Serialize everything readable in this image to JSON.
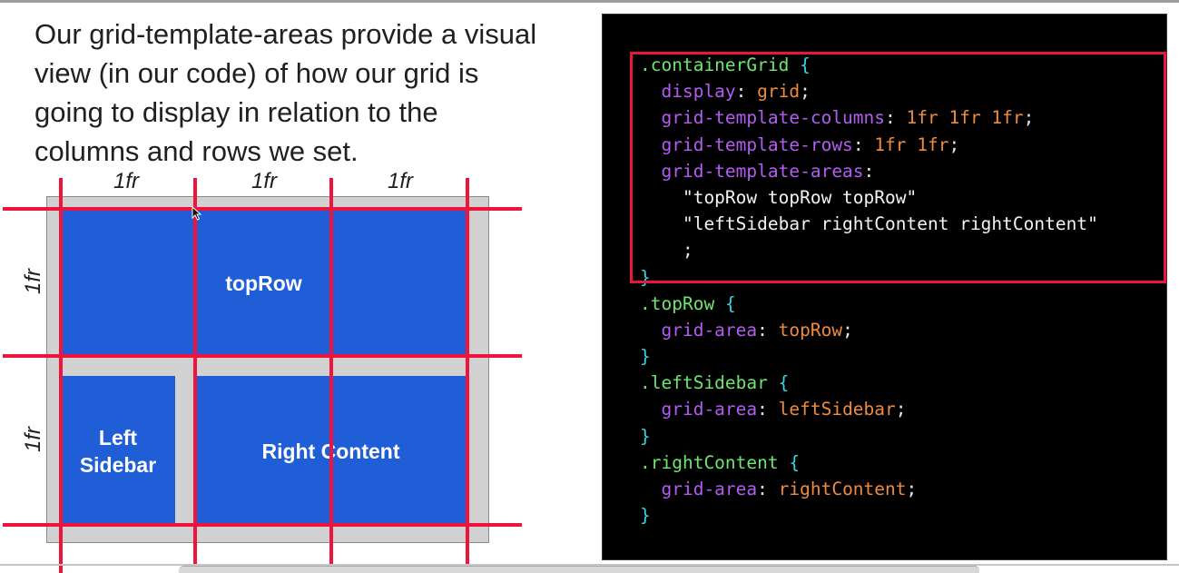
{
  "paragraph": {
    "lines": [
      "Our grid-template-areas provide a visual",
      "view (in our code) of how our grid is",
      "going to display in relation to the",
      "columns and rows we set."
    ]
  },
  "diagram": {
    "column_labels": [
      "1fr",
      "1fr",
      "1fr"
    ],
    "row_labels": [
      "1fr",
      "1fr"
    ],
    "areas": {
      "top": "topRow",
      "left": "Left\nSidebar",
      "right": "Right Content"
    },
    "colors": {
      "cell": "#1f5ed6",
      "gap": "#d1d1d1",
      "grid_line": "#f0143c"
    }
  },
  "code": {
    "lines": [
      [
        {
          "t": ".containerGrid",
          "c": "sel"
        },
        {
          "t": " ",
          "c": "punct"
        },
        {
          "t": "{",
          "c": "brace"
        }
      ],
      [
        {
          "t": "  display",
          "c": "prop"
        },
        {
          "t": ": ",
          "c": "punct"
        },
        {
          "t": "grid",
          "c": "val"
        },
        {
          "t": ";",
          "c": "punct"
        }
      ],
      [
        {
          "t": "  grid-template-columns",
          "c": "prop"
        },
        {
          "t": ": ",
          "c": "punct"
        },
        {
          "t": "1fr 1fr 1fr",
          "c": "val"
        },
        {
          "t": ";",
          "c": "punct"
        }
      ],
      [
        {
          "t": "  grid-template-rows",
          "c": "prop"
        },
        {
          "t": ": ",
          "c": "punct"
        },
        {
          "t": "1fr 1fr",
          "c": "val"
        },
        {
          "t": ";",
          "c": "punct"
        }
      ],
      [
        {
          "t": "  grid-template-areas",
          "c": "prop"
        },
        {
          "t": ":",
          "c": "punct"
        }
      ],
      [
        {
          "t": "    \"topRow topRow topRow\"",
          "c": "str"
        }
      ],
      [
        {
          "t": "    \"leftSidebar rightContent rightContent\"",
          "c": "str"
        }
      ],
      [
        {
          "t": "    ;",
          "c": "punct"
        }
      ],
      [
        {
          "t": "}",
          "c": "brace"
        }
      ],
      [
        {
          "t": ".topRow",
          "c": "sel"
        },
        {
          "t": " ",
          "c": "punct"
        },
        {
          "t": "{",
          "c": "brace"
        }
      ],
      [
        {
          "t": "  grid-area",
          "c": "prop"
        },
        {
          "t": ": ",
          "c": "punct"
        },
        {
          "t": "topRow",
          "c": "val"
        },
        {
          "t": ";",
          "c": "punct"
        }
      ],
      [
        {
          "t": "}",
          "c": "brace"
        }
      ],
      [
        {
          "t": ".leftSidebar",
          "c": "sel"
        },
        {
          "t": " ",
          "c": "punct"
        },
        {
          "t": "{",
          "c": "brace"
        }
      ],
      [
        {
          "t": "  grid-area",
          "c": "prop"
        },
        {
          "t": ": ",
          "c": "punct"
        },
        {
          "t": "leftSidebar",
          "c": "val"
        },
        {
          "t": ";",
          "c": "punct"
        }
      ],
      [
        {
          "t": "}",
          "c": "brace"
        }
      ],
      [
        {
          "t": ".rightContent",
          "c": "sel"
        },
        {
          "t": " ",
          "c": "punct"
        },
        {
          "t": "{",
          "c": "brace"
        }
      ],
      [
        {
          "t": "  grid-area",
          "c": "prop"
        },
        {
          "t": ": ",
          "c": "punct"
        },
        {
          "t": "rightContent",
          "c": "val"
        },
        {
          "t": ";",
          "c": "punct"
        }
      ],
      [
        {
          "t": "}",
          "c": "brace"
        }
      ]
    ],
    "colors": {
      "background": "#000000",
      "highlight_border": "#e8173d",
      "selector": "#6ee56e",
      "brace": "#33d6e0",
      "property": "#b35cf2",
      "value": "#f08a3c"
    }
  }
}
